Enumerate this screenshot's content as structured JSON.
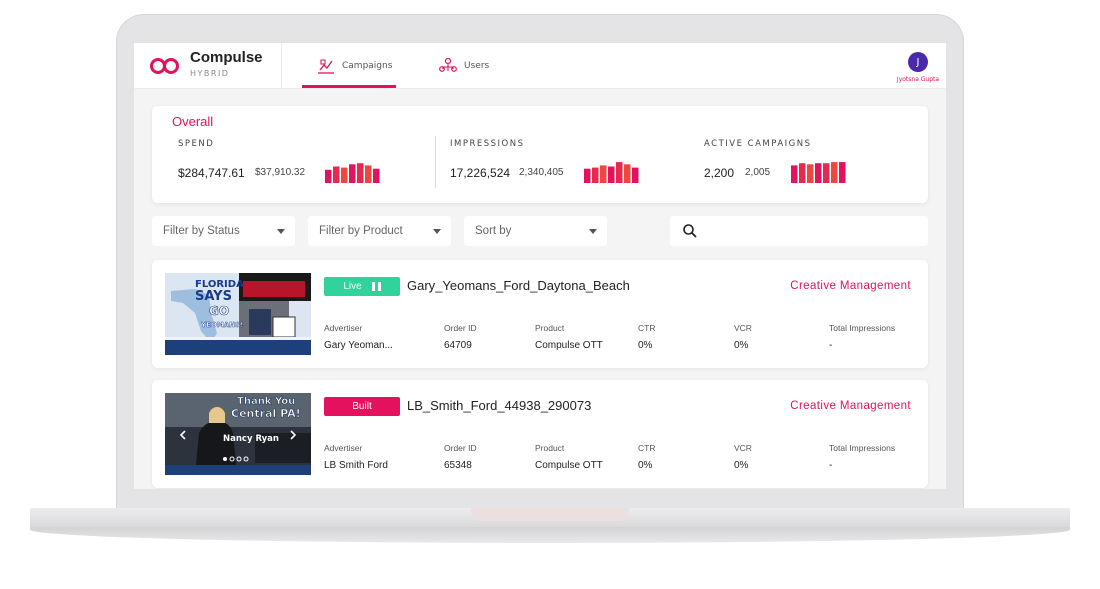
{
  "app": {
    "brand": "Compulse",
    "brand_sub": "HYBRID"
  },
  "nav": {
    "tabs": [
      {
        "label": "Campaigns",
        "active": true
      },
      {
        "label": "Users",
        "active": false
      }
    ]
  },
  "user": {
    "initial": "J",
    "name": "Jyotsna Gupta"
  },
  "colors": {
    "accent": "#e3115e",
    "live": "#2fd39b",
    "built": "#e3115e",
    "avatar": "#4a2aa8"
  },
  "overall": {
    "title": "Overall",
    "metrics": [
      {
        "label": "SPEND",
        "main": "$284,747.61",
        "sub": "$37,910.32",
        "bars": [
          0.6,
          0.75,
          0.7,
          0.85,
          0.9,
          0.8,
          0.65
        ]
      },
      {
        "label": "IMPRESSIONS",
        "main": "17,226,524",
        "sub": "2,340,405",
        "bars": [
          0.65,
          0.7,
          0.8,
          0.75,
          0.95,
          0.85,
          0.7
        ]
      },
      {
        "label": "ACTIVE CAMPAIGNS",
        "main": "2,200",
        "sub": "2,005",
        "bars": [
          0.8,
          0.9,
          0.85,
          0.9,
          0.9,
          0.95,
          0.95
        ]
      }
    ]
  },
  "filters": {
    "status": "Filter by Status",
    "product": "Filter by Product",
    "sort": "Sort by",
    "search_placeholder": ""
  },
  "campaign_fields": [
    "Advertiser",
    "Order ID",
    "Product",
    "CTR",
    "VCR",
    "Total Impressions"
  ],
  "campaigns": [
    {
      "status": "Live",
      "name": "Gary_Yeomans_Ford_Daytona_Beach",
      "action": "Creative Management",
      "advertiser": "Gary Yeoman...",
      "order_id": "64709",
      "product": "Compulse OTT",
      "ctr": "0%",
      "vcr": "0%",
      "impressions": "-",
      "thumb_text": [
        "FLORIDA",
        "SAYS",
        "GO",
        "YEOMANS!"
      ]
    },
    {
      "status": "Built",
      "name": "LB_Smith_Ford_44938_290073",
      "action": "Creative Management",
      "advertiser": "LB Smith Ford",
      "order_id": "65348",
      "product": "Compulse OTT",
      "ctr": "0%",
      "vcr": "0%",
      "impressions": "-",
      "thumb_text": [
        "Thank You",
        "Central PA!",
        "Nancy Ryan"
      ]
    }
  ]
}
